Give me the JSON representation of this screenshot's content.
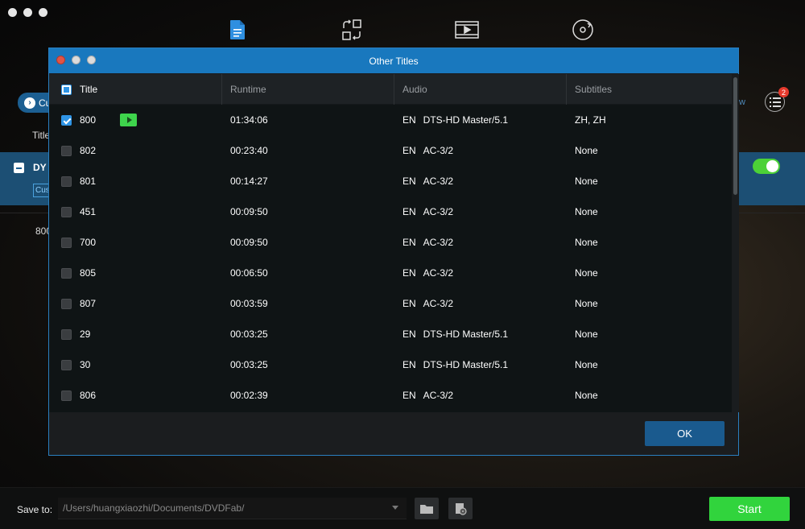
{
  "background": {
    "cu_label": "Cu",
    "title_col_label": "Title",
    "selected_row_label": "DY",
    "customize_label": "Cus",
    "row_800_label": "800",
    "view_fragment": "w",
    "queue_badge": "2"
  },
  "dialog": {
    "title": "Other Titles",
    "columns": {
      "title": "Title",
      "runtime": "Runtime",
      "audio": "Audio",
      "subtitles": "Subtitles"
    },
    "rows": [
      {
        "title": "800",
        "checked": true,
        "runtime": "01:34:06",
        "audio_lang": "EN",
        "audio_fmt": "DTS-HD Master/5.1",
        "subtitles": "ZH, ZH",
        "play": true
      },
      {
        "title": "802",
        "checked": false,
        "runtime": "00:23:40",
        "audio_lang": "EN",
        "audio_fmt": "AC-3/2",
        "subtitles": "None",
        "play": false
      },
      {
        "title": "801",
        "checked": false,
        "runtime": "00:14:27",
        "audio_lang": "EN",
        "audio_fmt": "AC-3/2",
        "subtitles": "None",
        "play": false
      },
      {
        "title": "451",
        "checked": false,
        "runtime": "00:09:50",
        "audio_lang": "EN",
        "audio_fmt": "AC-3/2",
        "subtitles": "None",
        "play": false
      },
      {
        "title": "700",
        "checked": false,
        "runtime": "00:09:50",
        "audio_lang": "EN",
        "audio_fmt": "AC-3/2",
        "subtitles": "None",
        "play": false
      },
      {
        "title": "805",
        "checked": false,
        "runtime": "00:06:50",
        "audio_lang": "EN",
        "audio_fmt": "AC-3/2",
        "subtitles": "None",
        "play": false
      },
      {
        "title": "807",
        "checked": false,
        "runtime": "00:03:59",
        "audio_lang": "EN",
        "audio_fmt": "AC-3/2",
        "subtitles": "None",
        "play": false
      },
      {
        "title": "29",
        "checked": false,
        "runtime": "00:03:25",
        "audio_lang": "EN",
        "audio_fmt": "DTS-HD Master/5.1",
        "subtitles": "None",
        "play": false
      },
      {
        "title": "30",
        "checked": false,
        "runtime": "00:03:25",
        "audio_lang": "EN",
        "audio_fmt": "DTS-HD Master/5.1",
        "subtitles": "None",
        "play": false
      },
      {
        "title": "806",
        "checked": false,
        "runtime": "00:02:39",
        "audio_lang": "EN",
        "audio_fmt": "AC-3/2",
        "subtitles": "None",
        "play": false
      }
    ],
    "ok_label": "OK"
  },
  "bottom": {
    "save_label": "Save to:",
    "save_path": "/Users/huangxiaozhi/Documents/DVDFab/",
    "start_label": "Start"
  },
  "icons": {
    "nav": [
      "document-icon",
      "convert-icon",
      "video-icon",
      "disc-burn-icon"
    ]
  },
  "colors": {
    "accent_blue": "#1978be",
    "ok_blue": "#1a5a8e",
    "start_green": "#31d43d",
    "play_green": "#3ed44c",
    "check_blue": "#2f95e6"
  }
}
